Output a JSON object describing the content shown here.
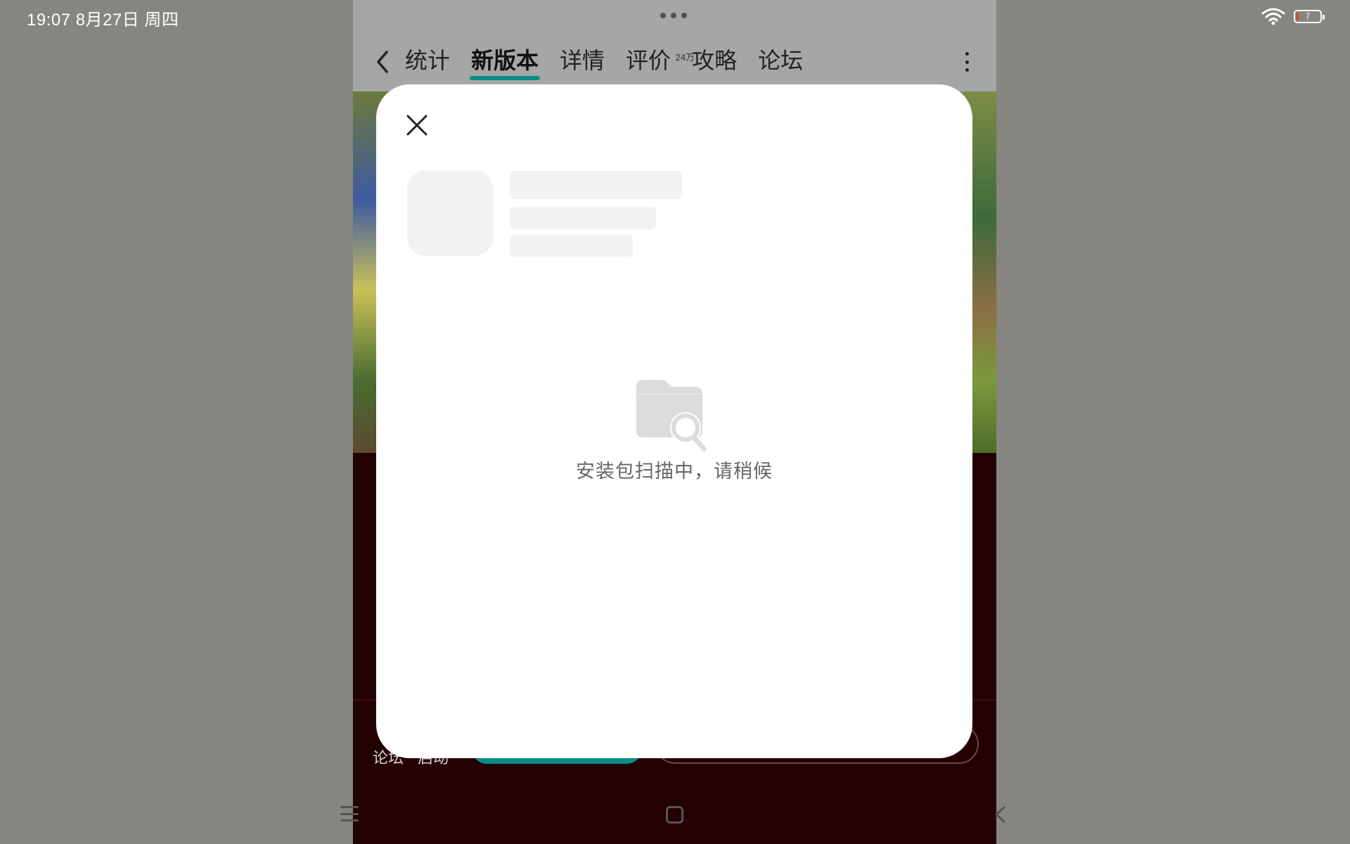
{
  "status_bar": {
    "time_date": "19:07   8月27日 周四",
    "battery_level": "7",
    "icons": [
      "wifi-icon",
      "battery-icon"
    ]
  },
  "header": {
    "tabs": [
      {
        "label": "统计",
        "active": false
      },
      {
        "label": "新版本",
        "active": true
      },
      {
        "label": "详情",
        "active": false
      },
      {
        "label": "评价",
        "active": false,
        "badge": "24万"
      },
      {
        "label": "攻略",
        "active": false
      },
      {
        "label": "论坛",
        "active": false
      }
    ],
    "accent_color": "#0b8f84"
  },
  "bottom_bar": {
    "labels": [
      "论坛",
      "启动"
    ]
  },
  "dialog": {
    "status_text": "安装包扫描中，请稍候",
    "icons": [
      "close-icon",
      "folder-search-icon"
    ]
  },
  "nav_bar": {
    "icons": [
      "menu-icon",
      "home-icon",
      "back-icon"
    ]
  }
}
